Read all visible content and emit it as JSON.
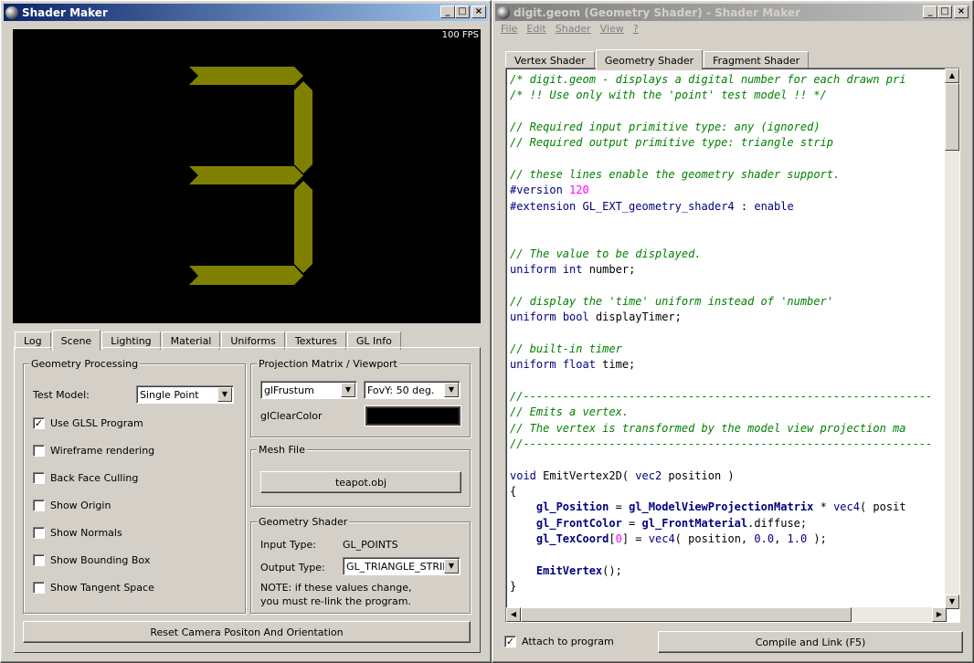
{
  "left_window": {
    "title": "Shader Maker",
    "fps": "100 FPS",
    "tabs": [
      "Log",
      "Scene",
      "Lighting",
      "Material",
      "Uniforms",
      "Textures",
      "GL Info"
    ],
    "selected_tab": "Scene",
    "geometry_processing": {
      "title": "Geometry Processing",
      "test_model_label": "Test Model:",
      "test_model_value": "Single Point",
      "checkboxes": [
        {
          "label": "Use GLSL Program",
          "checked": true
        },
        {
          "label": "Wireframe rendering",
          "checked": false
        },
        {
          "label": "Back Face Culling",
          "checked": false
        },
        {
          "label": "Show Origin",
          "checked": false
        },
        {
          "label": "Show Normals",
          "checked": false
        },
        {
          "label": "Show Bounding Box",
          "checked": false
        },
        {
          "label": "Show Tangent Space",
          "checked": false
        }
      ]
    },
    "projection": {
      "title": "Projection Matrix / Viewport",
      "matrix_value": "glFrustum",
      "fovy_value": "FovY: 50 deg.",
      "clear_color_label": "glClearColor",
      "clear_color": "#000000"
    },
    "mesh_file": {
      "title": "Mesh File",
      "button": "teapot.obj"
    },
    "geometry_shader": {
      "title": "Geometry Shader",
      "input_type_label": "Input Type:",
      "input_type_value": "GL_POINTS",
      "output_type_label": "Output Type:",
      "output_type_value": "GL_TRIANGLE_STRIP",
      "note_line1": "NOTE: if these values change,",
      "note_line2": "you must re-link the program."
    },
    "reset_button": "Reset Camera Positon And Orientation",
    "digit_color": "#808000"
  },
  "right_window": {
    "title": "digit.geom (Geometry Shader) - Shader Maker",
    "menus": [
      "File",
      "Edit",
      "Shader",
      "View",
      "?"
    ],
    "tabs": [
      "Vertex Shader",
      "Geometry Shader",
      "Fragment Shader"
    ],
    "selected_tab": "Geometry Shader",
    "code_lines": [
      "/* digit.geom - displays a digital number for each drawn pri",
      "/* !! Use only with the 'point' test model !! */",
      "",
      "// Required input primitive type: any (ignored)",
      "// Required output primitive type: triangle strip",
      "",
      "// these lines enable the geometry shader support.",
      "#version 120",
      "#extension GL_EXT_geometry_shader4 : enable",
      "",
      "",
      "// The value to be displayed.",
      "uniform int number;",
      "",
      "// display the 'time' uniform instead of 'number'",
      "uniform bool displayTimer;",
      "",
      "// built-in timer",
      "uniform float time;",
      "",
      "//--------------------------------------------------------------",
      "// Emits a vertex.",
      "// The vertex is transformed by the model view projection ma",
      "//--------------------------------------------------------------",
      "",
      "void EmitVertex2D( vec2 position )",
      "{",
      "    gl_Position = gl_ModelViewProjectionMatrix * vec4( posit",
      "    gl_FrontColor = gl_FrontMaterial.diffuse;",
      "    gl_TexCoord[0] = vec4( position, 0.0, 1.0 );",
      "",
      "    EmitVertex();",
      "}"
    ],
    "attach_label": "Attach to program",
    "attach_checked": true,
    "compile_button": "Compile and Link (F5)"
  }
}
